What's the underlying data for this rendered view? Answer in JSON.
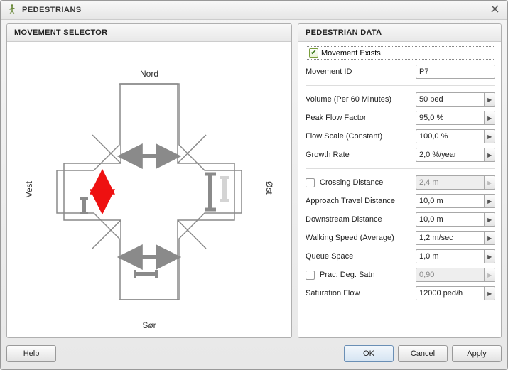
{
  "window": {
    "title": "PEDESTRIANS"
  },
  "panels": {
    "left_title": "MOVEMENT SELECTOR",
    "right_title": "PEDESTRIAN DATA"
  },
  "selector": {
    "north": "Nord",
    "south": "Sør",
    "east": "Øst",
    "west": "Vest"
  },
  "data": {
    "movement_exists": {
      "label": "Movement Exists",
      "checked": true
    },
    "movement_id": {
      "label": "Movement ID",
      "value": "P7"
    },
    "volume": {
      "label": "Volume (Per 60 Minutes)",
      "value": "50 ped"
    },
    "peak_flow": {
      "label": "Peak Flow Factor",
      "value": "95,0 %"
    },
    "flow_scale": {
      "label": "Flow Scale (Constant)",
      "value": "100,0 %"
    },
    "growth_rate": {
      "label": "Growth Rate",
      "value": "2,0 %/year"
    },
    "crossing_dist": {
      "label": "Crossing Distance",
      "value": "2,4 m",
      "checked": false,
      "enabled": false
    },
    "approach_dist": {
      "label": "Approach Travel Distance",
      "value": "10,0 m"
    },
    "downstream_dist": {
      "label": "Downstream Distance",
      "value": "10,0 m"
    },
    "walking_speed": {
      "label": "Walking Speed (Average)",
      "value": "1,2 m/sec"
    },
    "queue_space": {
      "label": "Queue Space",
      "value": "1,0 m"
    },
    "prac_deg_satn": {
      "label": "Prac. Deg. Satn",
      "value": "0,90",
      "checked": false,
      "enabled": false
    },
    "saturation_flow": {
      "label": "Saturation Flow",
      "value": "12000 ped/h"
    }
  },
  "buttons": {
    "help": "Help",
    "ok": "OK",
    "cancel": "Cancel",
    "apply": "Apply"
  }
}
